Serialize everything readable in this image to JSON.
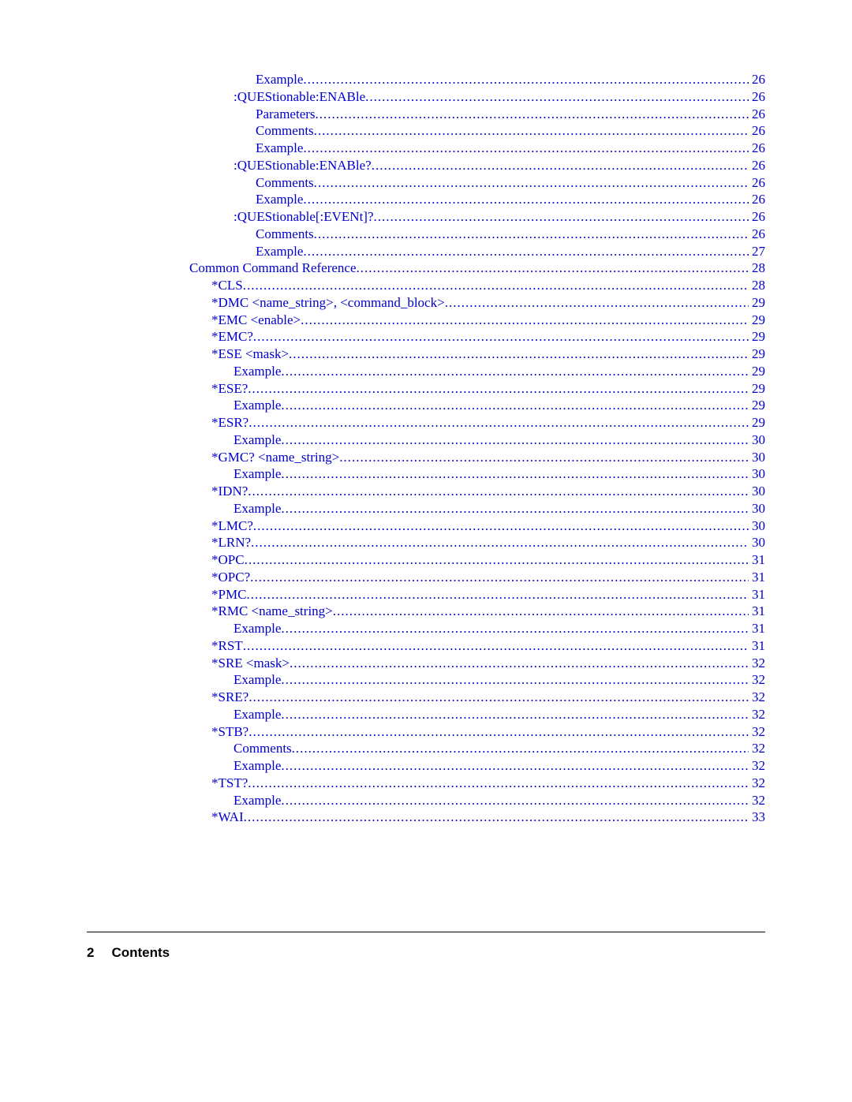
{
  "footer": {
    "pageNumber": "2",
    "label": "Contents"
  },
  "indentPx": 28,
  "baseIndent": 130,
  "toc": [
    {
      "level": 3,
      "label": "Example",
      "page": "26"
    },
    {
      "level": 2,
      "label": ":QUEStionable:ENABle",
      "page": "26"
    },
    {
      "level": 3,
      "label": "Parameters",
      "page": "26"
    },
    {
      "level": 3,
      "label": "Comments",
      "page": "26"
    },
    {
      "level": 3,
      "label": "Example",
      "page": "26"
    },
    {
      "level": 2,
      "label": ":QUEStionable:ENABle?",
      "page": "26"
    },
    {
      "level": 3,
      "label": "Comments",
      "page": "26"
    },
    {
      "level": 3,
      "label": "Example",
      "page": "26"
    },
    {
      "level": 2,
      "label": ":QUEStionable[:EVENt]?",
      "page": "26"
    },
    {
      "level": 3,
      "label": "Comments",
      "page": "26"
    },
    {
      "level": 3,
      "label": "Example",
      "page": "27"
    },
    {
      "level": 0,
      "label": "Common Command Reference",
      "page": "28"
    },
    {
      "level": 1,
      "label": "*CLS",
      "page": "28"
    },
    {
      "level": 1,
      "label": "*DMC <name_string>, <command_block>",
      "page": "29"
    },
    {
      "level": 1,
      "label": "*EMC <enable>",
      "page": "29"
    },
    {
      "level": 1,
      "label": "*EMC?",
      "page": "29"
    },
    {
      "level": 1,
      "label": "*ESE <mask>",
      "page": "29"
    },
    {
      "level": 2,
      "label": "Example",
      "page": "29"
    },
    {
      "level": 1,
      "label": "*ESE?",
      "page": "29"
    },
    {
      "level": 2,
      "label": "Example",
      "page": "29"
    },
    {
      "level": 1,
      "label": "*ESR?",
      "page": "29"
    },
    {
      "level": 2,
      "label": "Example",
      "page": "30"
    },
    {
      "level": 1,
      "label": "*GMC? <name_string>",
      "page": "30"
    },
    {
      "level": 2,
      "label": "Example",
      "page": "30"
    },
    {
      "level": 1,
      "label": "*IDN?",
      "page": "30"
    },
    {
      "level": 2,
      "label": "Example",
      "page": "30"
    },
    {
      "level": 1,
      "label": "*LMC?",
      "page": "30"
    },
    {
      "level": 1,
      "label": "*LRN?",
      "page": "30"
    },
    {
      "level": 1,
      "label": "*OPC",
      "page": "31"
    },
    {
      "level": 1,
      "label": "*OPC?",
      "page": "31"
    },
    {
      "level": 1,
      "label": "*PMC",
      "page": "31"
    },
    {
      "level": 1,
      "label": "*RMC <name_string>",
      "page": "31"
    },
    {
      "level": 2,
      "label": "Example",
      "page": "31"
    },
    {
      "level": 1,
      "label": "*RST",
      "page": "31"
    },
    {
      "level": 1,
      "label": "*SRE <mask>",
      "page": "32"
    },
    {
      "level": 2,
      "label": "Example",
      "page": "32"
    },
    {
      "level": 1,
      "label": "*SRE?",
      "page": "32"
    },
    {
      "level": 2,
      "label": "Example",
      "page": "32"
    },
    {
      "level": 1,
      "label": "*STB?",
      "page": "32"
    },
    {
      "level": 2,
      "label": "Comments",
      "page": "32"
    },
    {
      "level": 2,
      "label": "Example",
      "page": "32"
    },
    {
      "level": 1,
      "label": "*TST?",
      "page": "32"
    },
    {
      "level": 2,
      "label": "Example",
      "page": "32"
    },
    {
      "level": 1,
      "label": "*WAI",
      "page": "33"
    }
  ]
}
